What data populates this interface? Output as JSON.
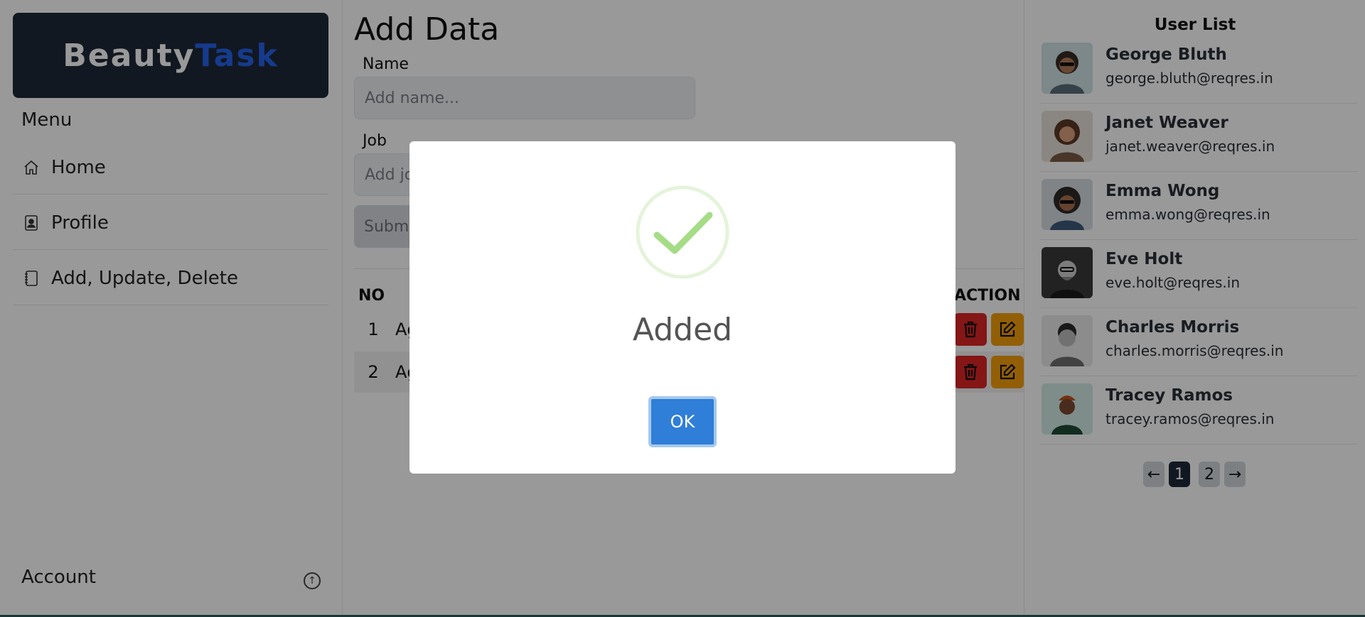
{
  "brand": {
    "part1": "Beauty",
    "part2": "Task"
  },
  "sidebar": {
    "menu_title": "Menu",
    "items": [
      {
        "label": "Home",
        "icon": "home-icon"
      },
      {
        "label": "Profile",
        "icon": "profile-icon"
      },
      {
        "label": "Add, Update, Delete",
        "icon": "notebook-icon"
      }
    ],
    "account_label": "Account"
  },
  "form": {
    "title": "Add Data",
    "name_label": "Name",
    "name_placeholder": "Add name...",
    "job_label": "Job",
    "job_placeholder": "Add jo",
    "submit_label": "Submi"
  },
  "table": {
    "headers": {
      "no": "NO",
      "action": "ACTION"
    },
    "rows": [
      {
        "no": "1",
        "name": "Ag"
      },
      {
        "no": "2",
        "name": "Ag"
      }
    ]
  },
  "user_list": {
    "title": "User List",
    "users": [
      {
        "name": "George Bluth",
        "email": "george.bluth@reqres.in"
      },
      {
        "name": "Janet Weaver",
        "email": "janet.weaver@reqres.in"
      },
      {
        "name": "Emma Wong",
        "email": "emma.wong@reqres.in"
      },
      {
        "name": "Eve Holt",
        "email": "eve.holt@reqres.in"
      },
      {
        "name": "Charles Morris",
        "email": "charles.morris@reqres.in"
      },
      {
        "name": "Tracey Ramos",
        "email": "tracey.ramos@reqres.in"
      }
    ],
    "pagination": {
      "prev": "←",
      "pages": [
        "1",
        "2"
      ],
      "active": "1",
      "next": "→"
    }
  },
  "modal": {
    "title": "Added",
    "ok_label": "OK",
    "icon": "success-check-icon"
  },
  "colors": {
    "brand_dark": "#1f2937",
    "brand_accent": "#2563eb",
    "delete": "#dc2626",
    "edit": "#f59e0b",
    "ok_button": "#2f7ed8",
    "check_green": "#a5dc86"
  }
}
